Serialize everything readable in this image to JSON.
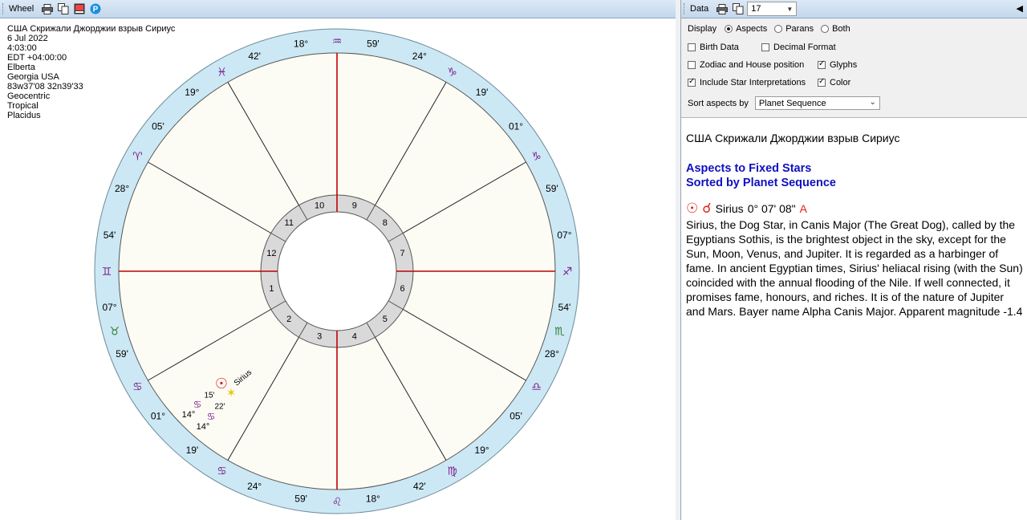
{
  "left_window": {
    "title": "Wheel",
    "toolbar_icons": [
      "print-icon",
      "copy-icon",
      "export-image-icon",
      "info-p-icon"
    ]
  },
  "chart_info": [
    "США Скрижали Джорджии взрыв Сириус",
    "6 Jul 2022",
    "4:03:00",
    "EDT +04:00:00",
    "Elberta",
    "Georgia USA",
    "83w37'08 32n39'33",
    "Geocentric",
    "Tropical",
    "Placidus"
  ],
  "wheel": {
    "house_numbers": [
      "1",
      "2",
      "3",
      "4",
      "5",
      "6",
      "7",
      "8",
      "9",
      "10",
      "11",
      "12"
    ],
    "cusp_labels": [
      {
        "deg": "18°",
        "sign": "♒",
        "min": "59'"
      },
      {
        "deg": "24°",
        "sign": "♑",
        "min": "19'"
      },
      {
        "deg": "01°",
        "sign": "♑",
        "min": "59'"
      },
      {
        "deg": "07°",
        "sign": "♐",
        "min": "54'"
      },
      {
        "deg": "28°",
        "sign": "♎",
        "min": "05'"
      },
      {
        "deg": "19°",
        "sign": "♍",
        "min": "42'"
      },
      {
        "deg": "18°",
        "sign": "♌",
        "min": "59'"
      },
      {
        "deg": "24°",
        "sign": "♋",
        "min": "19'"
      },
      {
        "deg": "01°",
        "sign": "♋",
        "min": "59'"
      },
      {
        "deg": "07°",
        "sign": "♊",
        "min": "54'"
      },
      {
        "deg": "28°",
        "sign": "♈",
        "min": "05'"
      },
      {
        "deg": "19°",
        "sign": "♓",
        "min": "42'"
      }
    ],
    "intercepted_signs": [
      "♉",
      "♏"
    ],
    "planets": {
      "sun_glyph": "☉",
      "star_name": "Sirius",
      "sun_min": "15'",
      "sign_glyph": "♋",
      "star_min": "22'",
      "sun_deg": "14°",
      "star_deg": "14°"
    },
    "colors": {
      "ring": "#cce8f4",
      "house": "#fdfcf4",
      "inner_ring": "#d9d9d9",
      "angle": "#c00000"
    }
  },
  "right_window": {
    "title": "Data",
    "dropdown_value": "17",
    "display_label": "Display",
    "radio_options": [
      "Aspects",
      "Parans",
      "Both"
    ],
    "radio_selected": "Aspects",
    "checkboxes": [
      {
        "label": "Birth Data",
        "checked": false
      },
      {
        "label": "Decimal Format",
        "checked": false
      },
      {
        "label": "Zodiac and House position",
        "checked": false
      },
      {
        "label": "Glyphs",
        "checked": true
      },
      {
        "label": "Include Star Interpretations",
        "checked": true
      },
      {
        "label": "Color",
        "checked": true
      }
    ],
    "sort_label": "Sort aspects by",
    "sort_value": "Planet Sequence"
  },
  "report": {
    "title": "США Скрижали Джорджии взрыв Сириус",
    "heading1": "Aspects to Fixed Stars",
    "heading2": "Sorted by Planet Sequence",
    "aspect": {
      "planet_glyph": "☉",
      "aspect_glyph": "☌",
      "star": "Sirius",
      "position": "0° 07' 08\"",
      "flag": "A"
    },
    "interpretation": "Sirius, the Dog Star, in Canis Major (The Great Dog), called by the Egyptians Sothis, is the brightest object in the sky, except for the Sun, Moon, Venus, and Jupiter. It is regarded as a harbinger of fame. In ancient Egyptian times, Sirius' heliacal rising (with the Sun) coincided with the annual flooding of the Nile. If well connected, it promises fame, honours, and riches. It is of the nature of Jupiter and Mars. Bayer name Alpha Canis Major. Apparent magnitude -1.4"
  }
}
